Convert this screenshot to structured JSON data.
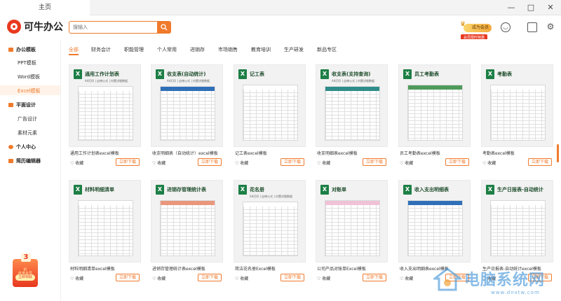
{
  "window": {
    "tab_title": "主页",
    "minimize": "—",
    "restore": "□",
    "close": "✕"
  },
  "header": {
    "brand": "可牛办公",
    "search_placeholder": "搜输入",
    "search_icon": "search-icon",
    "vip_label": "成为会员",
    "vip_sub": "会员限时特惠",
    "icons": [
      "user-icon",
      "monitor-icon",
      "settings-icon"
    ]
  },
  "sidebar": {
    "groups": [
      {
        "label": "办公模板",
        "items": [
          "PPT模板",
          "Word模板",
          "Excel模板"
        ]
      },
      {
        "label": "平面设计",
        "items": [
          "广告设计",
          "素材元素"
        ]
      },
      {
        "label": "个人中心",
        "items": []
      },
      {
        "label": "简历编辑器",
        "items": []
      }
    ],
    "active_item": "Excel模板",
    "promo": {
      "num": "3",
      "line1": "折",
      "line2": "终身会员",
      "button": "立即领取"
    }
  },
  "categories": [
    "全部",
    "财务会计",
    "职能管理",
    "个人常用",
    "进销存",
    "市场销售",
    "教育培训",
    "生产研发",
    "新品专区"
  ],
  "active_category": "全部",
  "cards_row1": [
    {
      "title": "通用工作计划表excel模板",
      "thumb_title": "通用工作计划表",
      "thumb_sub": "A4打印 | 自带公式 | 内置详细数据",
      "style": "plain"
    },
    {
      "title": "收支明细表（自动统计）excel模板",
      "thumb_title": "收支表(自动统计)",
      "thumb_sub": "A4打印 | 自带公式 | 内置详细数据",
      "style": "blue"
    },
    {
      "title": "记工表excel模板",
      "thumb_title": "记工表",
      "thumb_sub": "",
      "style": "grid"
    },
    {
      "title": "收支明细表excel模板",
      "thumb_title": "收支表(支持查询)",
      "thumb_sub": "A4打印 | 自带公式 | 内置详细数据",
      "style": "teal"
    },
    {
      "title": "员工考勤表excel模板",
      "thumb_title": "员工考勤表",
      "thumb_sub": "",
      "style": "green"
    },
    {
      "title": "考勤表excel模板",
      "thumb_title": "考勤表",
      "thumb_sub": "",
      "style": "grid"
    }
  ],
  "cards_row2": [
    {
      "title": "材料明细清单excel模板",
      "thumb_title": "材料明细清单",
      "thumb_sub": "",
      "style": "plain"
    },
    {
      "title": "进销存管理统计表excel模板",
      "thumb_title": "进销存管理统计表",
      "thumb_sub": "",
      "style": "salmon"
    },
    {
      "title": "简洁花名册Excel模板",
      "thumb_title": "花名册",
      "thumb_sub": "A4打印 | 自带公式 | 内置详细数据",
      "style": "grid"
    },
    {
      "title": "公司产品对账单Excel模板",
      "thumb_title": "对账单",
      "thumb_sub": "",
      "style": "pink"
    },
    {
      "title": "收入支出明细表excel模板",
      "thumb_title": "收入支出明细表",
      "thumb_sub": "",
      "style": "blue"
    },
    {
      "title": "生产日报表-自动统计excel模板",
      "thumb_title": "生产日报表-自动统计",
      "thumb_sub": "",
      "style": "plain"
    }
  ],
  "card_actions": {
    "favorite": "收藏",
    "download": "立即下载"
  },
  "watermark": {
    "text": "电脑系统网",
    "url": "www.dnxtw.com"
  },
  "colors": {
    "accent": "#f07a2c",
    "excel_green": "#1d7f45",
    "brand_red": "#e8381f"
  }
}
